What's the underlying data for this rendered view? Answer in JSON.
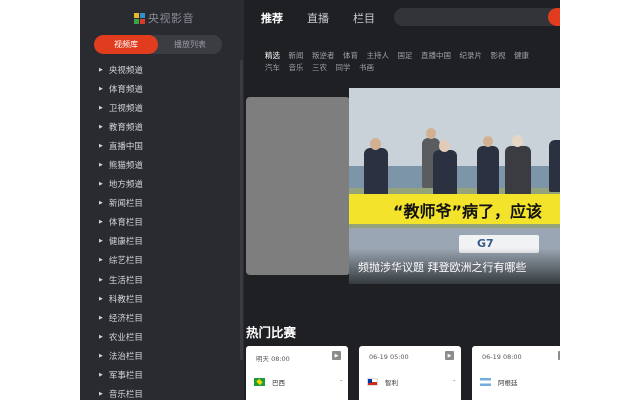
{
  "app": {
    "logo_text": "央视影音"
  },
  "sidebar": {
    "tabs": [
      {
        "label": "视频库"
      },
      {
        "label": "播放列表"
      }
    ],
    "items": [
      {
        "label": "央视频道"
      },
      {
        "label": "体育频道"
      },
      {
        "label": "卫视频道"
      },
      {
        "label": "教育频道"
      },
      {
        "label": "直播中国"
      },
      {
        "label": "熊猫频道"
      },
      {
        "label": "地方频道"
      },
      {
        "label": "新闻栏目"
      },
      {
        "label": "体育栏目"
      },
      {
        "label": "健康栏目"
      },
      {
        "label": "综艺栏目"
      },
      {
        "label": "生活栏目"
      },
      {
        "label": "科教栏目"
      },
      {
        "label": "经济栏目"
      },
      {
        "label": "农业栏目"
      },
      {
        "label": "法治栏目"
      },
      {
        "label": "军事栏目"
      },
      {
        "label": "音乐栏目"
      }
    ]
  },
  "nav": {
    "tabs": [
      {
        "label": "推荐"
      },
      {
        "label": "直播"
      },
      {
        "label": "栏目"
      }
    ],
    "search_placeholder": ""
  },
  "categories": {
    "row1": [
      "精选",
      "新闻",
      "叛逆者",
      "体育",
      "主持人",
      "国足",
      "直播中国",
      "纪录片",
      "影视",
      "健康"
    ],
    "row2": [
      "汽车",
      "音乐",
      "三农",
      "同学",
      "书画"
    ]
  },
  "banner": {
    "headline_overlay": "“教师爷”病了，应该",
    "sign_text": "G7",
    "caption": "频抛涉华议题 拜登欧洲之行有哪些"
  },
  "hot_matches": {
    "title": "热门比赛",
    "matches": [
      {
        "time": "明天 08:00",
        "team": "巴西",
        "score": "-",
        "flag_colors": [
          "#1f9b3a",
          "#f5d800"
        ]
      },
      {
        "time": "06-19 05:00",
        "team": "智利",
        "score": "-",
        "flag_colors": [
          "#ffffff",
          "#d52b1e"
        ]
      },
      {
        "time": "06-19 08:00",
        "team": "阿根廷",
        "score": "-",
        "flag_colors": [
          "#74acdf",
          "#ffffff"
        ]
      }
    ]
  },
  "colors": {
    "accent": "#e13c1e",
    "background": "#1f2024",
    "sidebar": "#2a2b30"
  }
}
